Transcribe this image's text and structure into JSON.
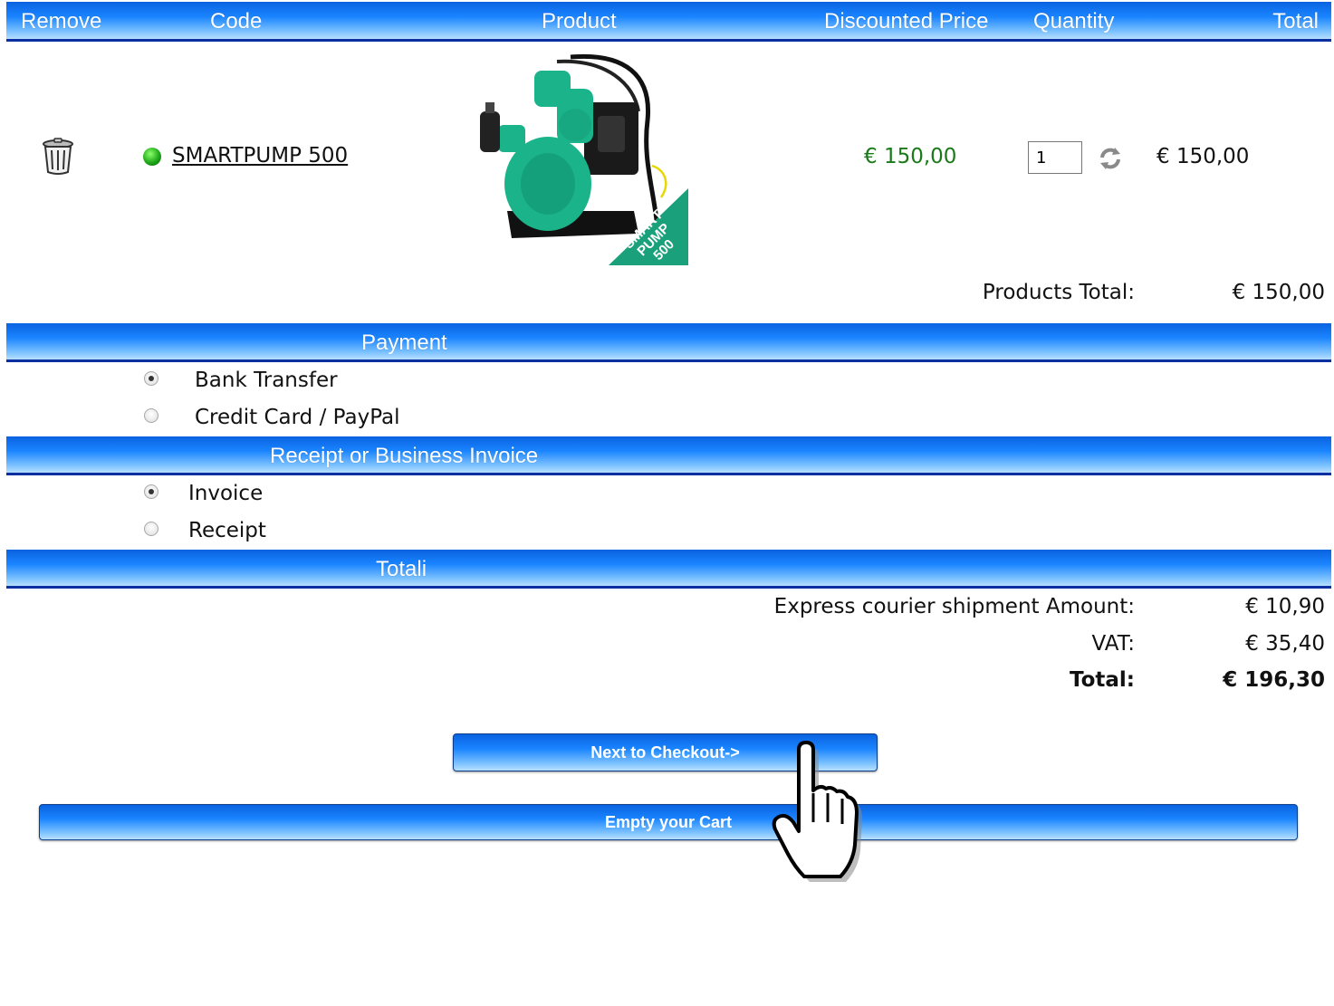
{
  "header": {
    "remove": "Remove",
    "code": "Code",
    "product": "Product",
    "discounted_price": "Discounted Price",
    "quantity": "Quantity",
    "total": "Total"
  },
  "cart_item": {
    "remove_icon": "trash-icon",
    "status_icon": "green-dot-icon",
    "code": "SMARTPUMP 500",
    "image_label": [
      "SMART",
      "PUMP",
      "500"
    ],
    "discounted_price": "€ 150,00",
    "quantity": "1",
    "refresh_icon": "refresh-icon",
    "total": "€ 150,00"
  },
  "products_total": {
    "label": "Products Total:",
    "value": "€ 150,00"
  },
  "payment": {
    "title": "Payment",
    "options": [
      {
        "label": "Bank Transfer",
        "checked": true
      },
      {
        "label": "Credit Card / PayPal",
        "checked": false
      }
    ]
  },
  "receipt": {
    "title": "Receipt or Business Invoice",
    "options": [
      {
        "label": "Invoice",
        "checked": true
      },
      {
        "label": "Receipt",
        "checked": false
      }
    ]
  },
  "totals": {
    "title": "Totali",
    "shipment_label": "Express courier shipment Amount:",
    "shipment_value": "€ 10,90",
    "vat_label": "VAT:",
    "vat_value": "€ 35,40",
    "total_label": "Total:",
    "total_value": "€ 196,30"
  },
  "buttons": {
    "checkout": "Next to Checkout->",
    "empty_cart": "Empty your Cart"
  },
  "colors": {
    "bar_top": "#0a63e0",
    "bar_bottom": "#b8dfff",
    "bar_border": "#0a2fa0",
    "price_green": "#1a7a1a",
    "pump_green": "#1bb48a"
  },
  "cursor_icon": "hand-pointer-icon"
}
